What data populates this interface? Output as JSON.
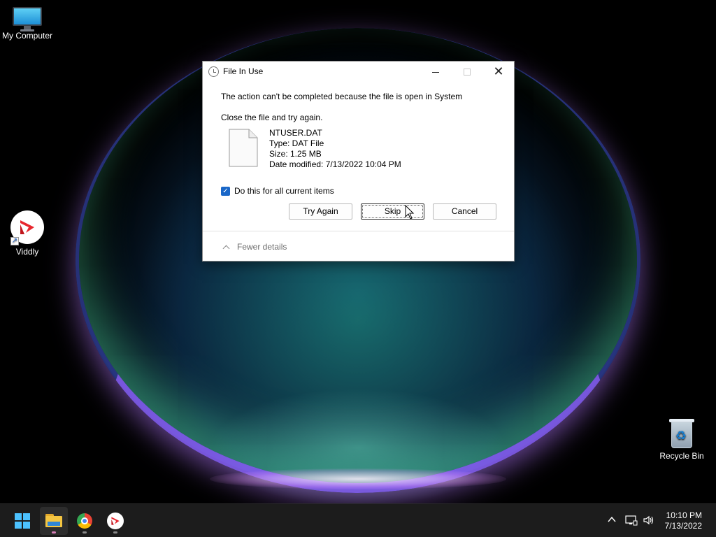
{
  "desktop": {
    "icons": [
      {
        "label": "My Computer",
        "icon": "computer-icon"
      },
      {
        "label": "Viddly",
        "icon": "viddly-icon"
      },
      {
        "label": "Recycle Bin",
        "icon": "recycle-bin-icon"
      }
    ]
  },
  "dialog": {
    "title": "File In Use",
    "message": "The action can't be completed because the file is open in System",
    "instruction": "Close the file and try again.",
    "file": {
      "name": "NTUSER.DAT",
      "type": "Type: DAT File",
      "size": "Size: 1.25 MB",
      "modified": "Date modified: 7/13/2022 10:04 PM"
    },
    "checkbox": {
      "label": "Do this for all current items",
      "checked": true
    },
    "buttons": {
      "try_again": "Try Again",
      "skip": "Skip",
      "cancel": "Cancel"
    },
    "details_toggle": "Fewer details"
  },
  "taskbar": {
    "items": [
      {
        "name": "start",
        "icon": "windows-start-icon"
      },
      {
        "name": "file-explorer",
        "icon": "folder-icon"
      },
      {
        "name": "chrome",
        "icon": "chrome-icon"
      },
      {
        "name": "viddly",
        "icon": "viddly-icon"
      }
    ],
    "tray": {
      "time": "10:10 PM",
      "date": "7/13/2022"
    }
  },
  "colors": {
    "accent": "#1a67c8",
    "taskbar": "#1c1c1c",
    "start_icon": "#4cc2ff",
    "viddly_red": "#e8262d"
  }
}
